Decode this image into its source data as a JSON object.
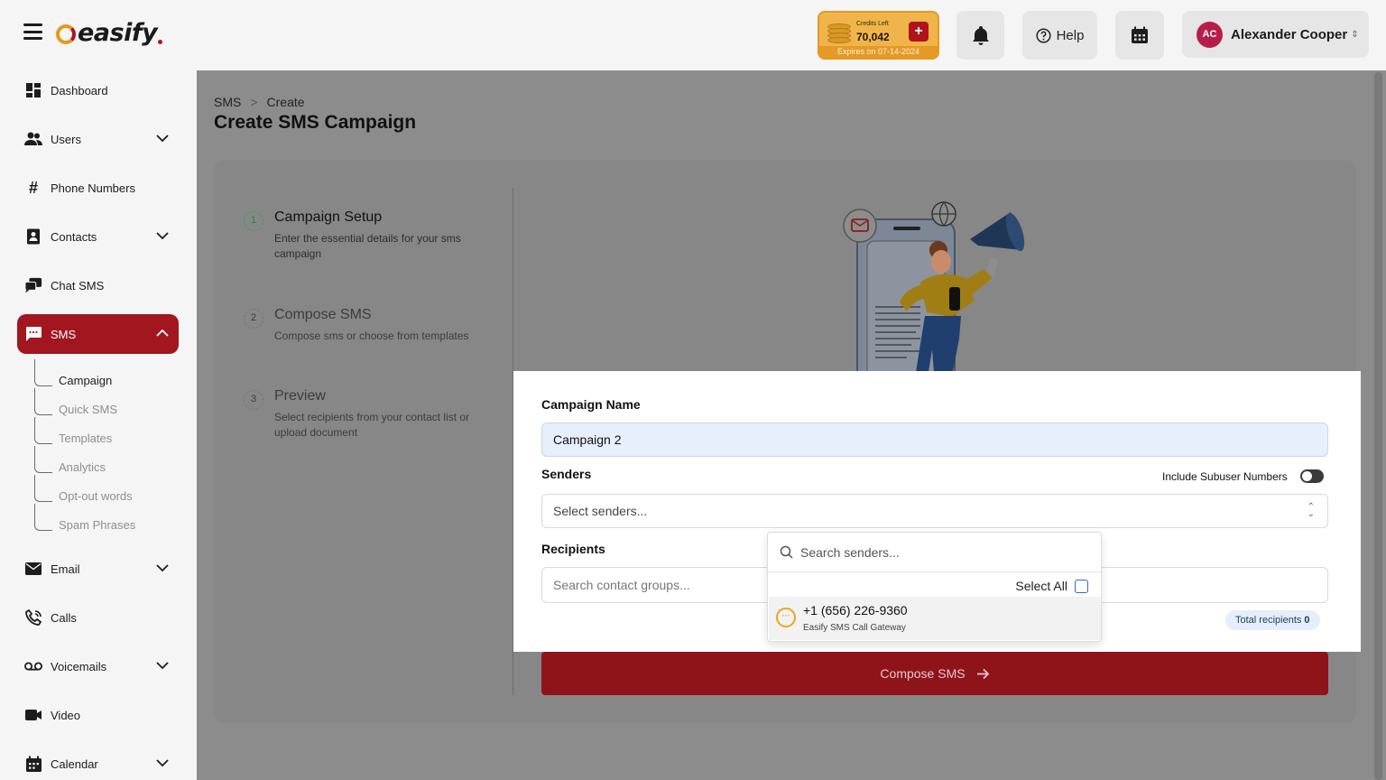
{
  "app": {
    "logo_text": "easify"
  },
  "header": {
    "credits": {
      "label": "Credits Left",
      "value": "70,042",
      "plus": "+",
      "expiry": "Expires on 07-14-2024"
    },
    "help_label": "Help",
    "user": {
      "initials": "AC",
      "name": "Alexander Cooper"
    }
  },
  "sidebar": {
    "items": [
      {
        "label": "Dashboard",
        "icon": "dashboard-icon"
      },
      {
        "label": "Users",
        "icon": "users-icon",
        "expandable": true
      },
      {
        "label": "Phone Numbers",
        "icon": "hash-icon"
      },
      {
        "label": "Contacts",
        "icon": "contacts-icon",
        "expandable": true
      },
      {
        "label": "Chat SMS",
        "icon": "chat-icon"
      },
      {
        "label": "SMS",
        "icon": "sms-icon",
        "expandable": true,
        "active": true
      },
      {
        "label": "Email",
        "icon": "email-icon",
        "expandable": true
      },
      {
        "label": "Calls",
        "icon": "phone-icon"
      },
      {
        "label": "Voicemails",
        "icon": "voicemail-icon",
        "expandable": true
      },
      {
        "label": "Video",
        "icon": "video-icon"
      },
      {
        "label": "Calendar",
        "icon": "calendar-icon",
        "expandable": true
      }
    ],
    "sms_sub": [
      "Campaign",
      "Quick SMS",
      "Templates",
      "Analytics",
      "Opt-out words",
      "Spam Phrases"
    ]
  },
  "breadcrumb": {
    "root": "SMS",
    "separator": ">",
    "current": "Create"
  },
  "page_title": "Create SMS Campaign",
  "steps": [
    {
      "num": "1",
      "title": "Campaign Setup",
      "desc": "Enter the essential details for your sms campaign"
    },
    {
      "num": "2",
      "title": "Compose SMS",
      "desc": "Compose sms or choose from templates"
    },
    {
      "num": "3",
      "title": "Preview",
      "desc": "Select recipients from your contact list or upload document"
    }
  ],
  "form": {
    "campaign_name_label": "Campaign Name",
    "campaign_name_value": "Campaign 2",
    "senders_label": "Senders",
    "include_subuser_label": "Include Subuser Numbers",
    "include_subuser_on": false,
    "senders_placeholder": "Select senders...",
    "recipients_label": "Recipients",
    "recipients_placeholder": "Search contact groups...",
    "total_recipients_label": "Total recipients",
    "total_recipients_value": "0",
    "compose_button": "Compose SMS"
  },
  "sender_dropdown": {
    "search_placeholder": "Search senders...",
    "select_all_label": "Select All",
    "options": [
      {
        "number": "+1 (656) 226-9360",
        "gateway": "Easify SMS Call Gateway"
      }
    ]
  },
  "colors": {
    "brand_red": "#a2161f",
    "accent_orange": "#f0a41a",
    "avatar": "#b81d49"
  }
}
